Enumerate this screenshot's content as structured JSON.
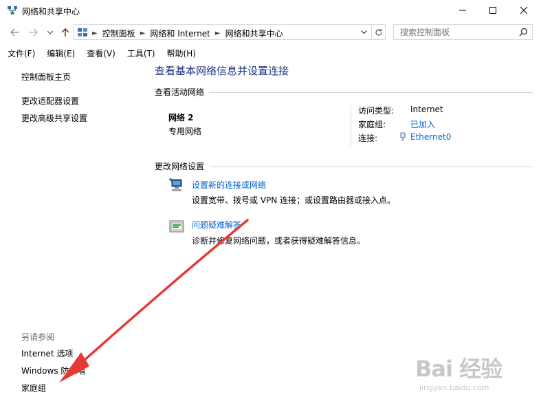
{
  "window": {
    "title": "网络和共享中心"
  },
  "address": {
    "crumbs": [
      "控制面板",
      "网络和 Internet",
      "网络和共享中心"
    ],
    "search_placeholder": "搜索控制面板"
  },
  "menu": [
    "文件(F)",
    "编辑(E)",
    "查看(V)",
    "工具(T)",
    "帮助(H)"
  ],
  "sidebar": {
    "home": "控制面板主页",
    "links": [
      "更改适配器设置",
      "更改高级共享设置"
    ],
    "see_also_label": "另请参阅",
    "see_also": [
      "Internet 选项",
      "Windows 防火墙",
      "家庭组"
    ]
  },
  "main": {
    "title": "查看基本网络信息并设置连接",
    "active_networks_label": "查看活动网络",
    "network_name": "网络  2",
    "network_type": "专用网络",
    "access_type_label": "访问类型:",
    "access_type_value": "Internet",
    "homegroup_label": "家庭组:",
    "homegroup_value": "已加入",
    "connection_label": "连接:",
    "connection_value": "Ethernet0",
    "change_settings_label": "更改网络设置",
    "tasks": [
      {
        "title": "设置新的连接或网络",
        "desc": "设置宽带、拨号或 VPN 连接；或设置路由器或接入点。",
        "icon": "new-connection-icon"
      },
      {
        "title": "问题疑难解答",
        "desc": "诊断并修复网络问题，或者获得疑难解答信息。",
        "icon": "troubleshoot-icon"
      }
    ]
  },
  "watermark": {
    "logo": "Bai 经验",
    "url": "jingyan.baidu.com"
  },
  "colors": {
    "link": "#0066cc",
    "title": "#1e3287",
    "arrow": "#e53935"
  }
}
